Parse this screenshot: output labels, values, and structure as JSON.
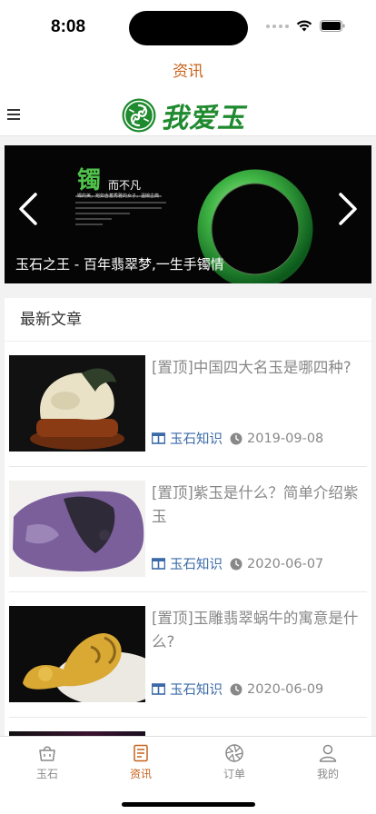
{
  "status_bar": {
    "time": "8:08"
  },
  "page_title": "资讯",
  "brand": {
    "name": "我爱玉",
    "color": "#1f8a2e"
  },
  "banner": {
    "caption": "玉石之王 - 百年翡翠梦,一生手镯情",
    "headline_char": "镯",
    "headline_rest": "而不凡",
    "tagline": "镯的美，宛如含蓄秀雅的女子，温婉古典"
  },
  "section_title": "最新文章",
  "articles": [
    {
      "title": "[置顶]中国四大名玉是哪四种?",
      "category": "玉石知识",
      "date": "2019-09-08",
      "thumb": "white-jade-carving"
    },
    {
      "title": "[置顶]紫玉是什么？简单介绍紫玉",
      "category": "玉石知识",
      "date": "2020-06-07",
      "thumb": "purple-jade-stone"
    },
    {
      "title": "[置顶]玉雕翡翠蜗牛的寓意是什么?",
      "category": "玉石知识",
      "date": "2020-06-09",
      "thumb": "jade-snail"
    }
  ],
  "tabs": [
    {
      "label": "玉石",
      "icon": "bag-icon",
      "active": false
    },
    {
      "label": "资讯",
      "icon": "news-icon",
      "active": true
    },
    {
      "label": "订单",
      "icon": "aperture-icon",
      "active": false
    },
    {
      "label": "我的",
      "icon": "user-icon",
      "active": false
    }
  ],
  "colors": {
    "accent": "#c8611b",
    "link": "#3b6aa8"
  }
}
